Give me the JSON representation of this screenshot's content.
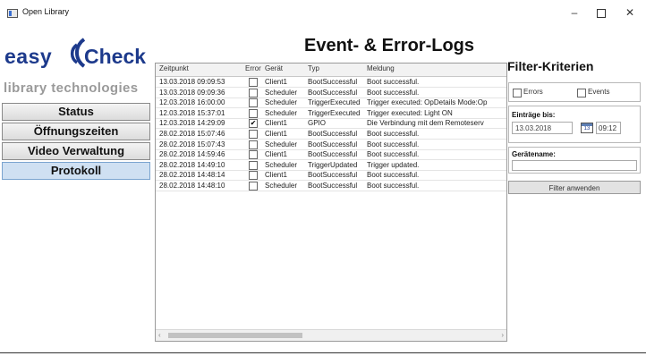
{
  "window": {
    "title": "Open Library",
    "minimize": "–",
    "close": "✕"
  },
  "logo": {
    "easy": "easy",
    "check": "Check",
    "subtitle": "library technologies"
  },
  "nav": {
    "items": [
      {
        "label": "Status"
      },
      {
        "label": "Öffnungszeiten"
      },
      {
        "label": "Video Verwaltung"
      },
      {
        "label": "Protokoll"
      }
    ]
  },
  "page": {
    "title": "Event- & Error-Logs"
  },
  "table": {
    "columns": [
      "Zeitpunkt",
      "Error",
      "Gerät",
      "Typ",
      "Meldung"
    ],
    "rows": [
      {
        "time": "13.03.2018 09:09:53",
        "error": false,
        "device": "Client1",
        "type": "BootSuccessful",
        "message": "Boot successful."
      },
      {
        "time": "13.03.2018 09:09:36",
        "error": false,
        "device": "Scheduler",
        "type": "BootSuccessful",
        "message": "Boot successful."
      },
      {
        "time": "12.03.2018 16:00:00",
        "error": false,
        "device": "Scheduler",
        "type": "TriggerExecuted",
        "message": "Trigger executed: OpDetails Mode:Op"
      },
      {
        "time": "12.03.2018 15:37:01",
        "error": false,
        "device": "Scheduler",
        "type": "TriggerExecuted",
        "message": "Trigger executed: Light ON"
      },
      {
        "time": "12.03.2018 14:29:09",
        "error": true,
        "device": "Client1",
        "type": "GPIO",
        "message": "Die Verbindung mit dem Remoteserv"
      },
      {
        "time": "28.02.2018 15:07:46",
        "error": false,
        "device": "Client1",
        "type": "BootSuccessful",
        "message": "Boot successful."
      },
      {
        "time": "28.02.2018 15:07:43",
        "error": false,
        "device": "Scheduler",
        "type": "BootSuccessful",
        "message": "Boot successful."
      },
      {
        "time": "28.02.2018 14:59:46",
        "error": false,
        "device": "Client1",
        "type": "BootSuccessful",
        "message": "Boot successful."
      },
      {
        "time": "28.02.2018 14:49:10",
        "error": false,
        "device": "Scheduler",
        "type": "TriggerUpdated",
        "message": "Trigger updated."
      },
      {
        "time": "28.02.2018 14:48:14",
        "error": false,
        "device": "Client1",
        "type": "BootSuccessful",
        "message": "Boot successful."
      },
      {
        "time": "28.02.2018 14:48:10",
        "error": false,
        "device": "Scheduler",
        "type": "BootSuccessful",
        "message": "Boot successful."
      }
    ]
  },
  "filter": {
    "title": "Filter-Kriterien",
    "errors_label": "Errors",
    "events_label": "Events",
    "entries_until_label": "Einträge bis:",
    "date_value": "13.03.2018",
    "calendar_day": "13",
    "time_value": "09:12",
    "device_name_label": "Gerätename:",
    "device_name_value": "",
    "apply_label": "Filter anwenden"
  },
  "colors": {
    "brand": "#1d3a8c",
    "logo_gray": "#9a9a9a",
    "nav_active": "#cfe0f2"
  }
}
